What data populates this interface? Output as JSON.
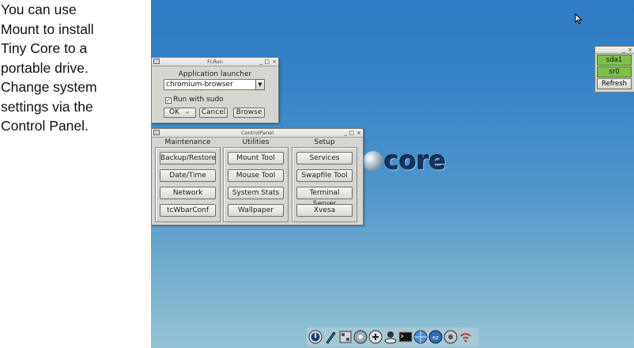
{
  "caption": {
    "text": "You can use\nMount to install\nTiny Core to a\nportable drive.\nChange system\nsettings via the\nControl Panel."
  },
  "desktop": {
    "logo_text": "core"
  },
  "flrun": {
    "title": "FLRun",
    "heading": "Application launcher",
    "input_value": "chromium-browser",
    "checkbox_label": "Run with sudo",
    "checkbox_checked": true,
    "ok_label": "OK",
    "cancel_label": "Cancel",
    "browse_label": "Browse"
  },
  "control_panel": {
    "title": "ControlPanel",
    "columns": [
      {
        "heading": "Maintenance",
        "items": [
          "Backup/Restore",
          "Date/Time",
          "Network",
          "tcWbarConf"
        ]
      },
      {
        "heading": "Utilities",
        "items": [
          "Mount Tool",
          "Mouse Tool",
          "System Stats",
          "Wallpaper"
        ]
      },
      {
        "heading": "Setup",
        "items": [
          "Services",
          "Swapfile Tool",
          "Terminal Server",
          "Xvesa"
        ]
      }
    ]
  },
  "mount_panel": {
    "items": [
      "sda1",
      "sr0"
    ],
    "refresh_label": "Refresh",
    "mounted_color": "#7ec04a"
  },
  "window_controls": {
    "minimize": "_",
    "maximize": "□",
    "close": "×"
  },
  "dock": {
    "icons": [
      "power-icon",
      "editor-icon",
      "control-panel-icon",
      "apps-icon",
      "mount-icon",
      "run-icon",
      "terminal-icon",
      "browser-icon",
      "ezremaster-icon",
      "settings-icon",
      "wifi-icon"
    ]
  }
}
